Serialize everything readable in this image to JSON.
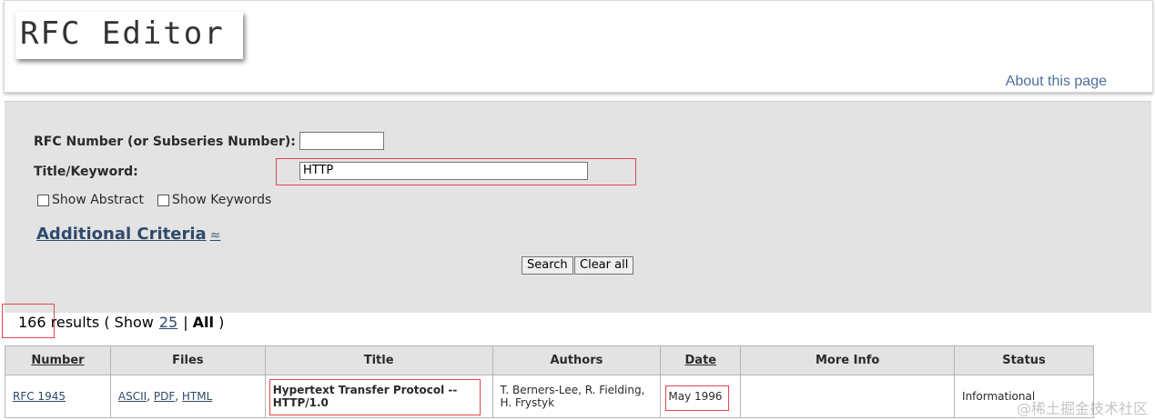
{
  "header": {
    "logo_text": "RFC Editor",
    "about_link": "About this page"
  },
  "search": {
    "rfc_number_label": "RFC Number (or Subseries Number):",
    "rfc_number_value": "",
    "title_keyword_label": "Title/Keyword:",
    "title_keyword_value": "HTTP",
    "show_abstract_label": "Show Abstract",
    "show_keywords_label": "Show Keywords",
    "additional_criteria": "Additional Criteria",
    "search_button": "Search",
    "clear_button": "Clear all"
  },
  "results": {
    "count": "166",
    "text": "results ( Show",
    "show_25": "25",
    "separator": "|",
    "all": "All",
    "close": ")"
  },
  "table": {
    "headers": [
      "Number",
      "Files",
      "Title",
      "Authors",
      "Date",
      "More Info",
      "Status"
    ],
    "rows": [
      {
        "number": "RFC 1945",
        "files": [
          "ASCII",
          "PDF",
          "HTML"
        ],
        "title_line1": "Hypertext Transfer Protocol --",
        "title_line2": "HTTP/1.0",
        "authors_line1": "T. Berners-Lee, R. Fielding,",
        "authors_line2": "H. Frystyk",
        "date": "May 1996",
        "more_info": "",
        "status": "Informational"
      }
    ]
  },
  "watermark": "@稀土掘金技术社区",
  "colors": {
    "panel_bg": "#e3e3e3",
    "link": "#2e4a6b",
    "highlight_box": "#e0474c"
  }
}
